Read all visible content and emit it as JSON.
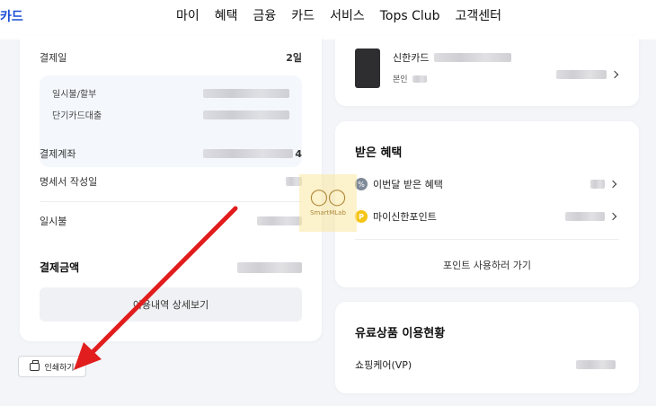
{
  "header": {
    "logo": "카드",
    "nav": [
      "마이",
      "혜택",
      "금융",
      "카드",
      "서비스",
      "Tops Club",
      "고객센터"
    ]
  },
  "billing": {
    "pay_day_label": "결제일",
    "pay_day_value": "2일",
    "installment_label": "일시불/할부",
    "short_loan_label": "단기카드대출",
    "account_label": "결제계좌",
    "account_value_tail": "4",
    "statement_label": "명세서 작성일",
    "lump_label": "일시불",
    "total_label": "결제금액",
    "detail_button": "이용내역 상세보기"
  },
  "print_button": "인쇄하기",
  "card_summary": {
    "card_name": "신한카드",
    "owner": "본인"
  },
  "benefits": {
    "title": "받은 혜택",
    "month_benefit": "이번달 받은 혜택",
    "point_label": "마이신한포인트",
    "use_points_link": "포인트 사용하러 가기",
    "pct_icon": "%",
    "p_icon": "P"
  },
  "paid_products": {
    "title": "유료상품 이용현황",
    "item": "쇼핑케어(VP)"
  },
  "watermark": {
    "text": "SmartMLab"
  },
  "colors": {
    "brand": "#1a4fd6",
    "arrow": "#e11d1d",
    "background": "#f3f5f9"
  }
}
